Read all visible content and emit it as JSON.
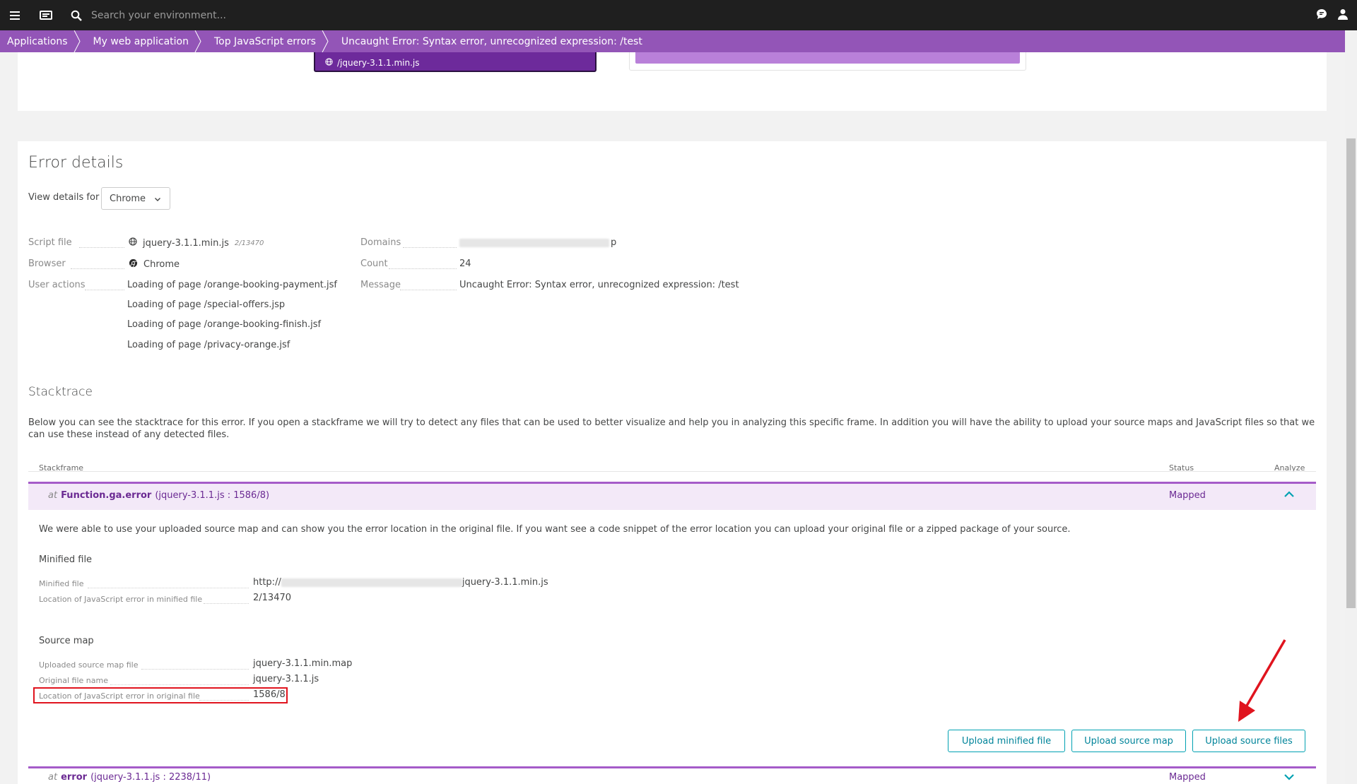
{
  "topbar": {
    "search_placeholder": "Search your environment...",
    "icons": [
      "menu-icon",
      "dashboard-icon",
      "search-icon",
      "chat-icon",
      "user-icon"
    ]
  },
  "breadcrumb": [
    "Applications",
    "My web application",
    "Top JavaScript errors",
    "Uncaught Error: Syntax error, unrecognized expression: /test"
  ],
  "top_card": {
    "tile_label": "/jquery-3.1.1.min.js"
  },
  "error_details": {
    "title": "Error details",
    "view_details_label": "View details for",
    "selected_browser": "Chrome",
    "left": [
      {
        "label": "Script file",
        "value": "jquery-3.1.1.min.js",
        "note": "2/13470",
        "icon": "globe-icon"
      },
      {
        "label": "Browser",
        "value": "Chrome",
        "icon": "chrome-icon"
      },
      {
        "label": "User actions",
        "values": [
          "Loading of page /orange-booking-payment.jsf",
          "Loading of page /special-offers.jsp",
          "Loading of page /orange-booking-finish.jsf",
          "Loading of page /privacy-orange.jsf"
        ]
      }
    ],
    "right": [
      {
        "label": "Domains",
        "value_suffix": "p"
      },
      {
        "label": "Count",
        "value": "24"
      },
      {
        "label": "Message",
        "value": "Uncaught Error: Syntax error, unrecognized expression: /test"
      }
    ]
  },
  "stacktrace": {
    "title": "Stacktrace",
    "description": "Below you can see the stacktrace for this error. If you open a stackframe we will try to detect any files that can be used to better visualize and help you in analyzing this specific frame. In addition you will have the ability to upload your source maps and JavaScript files so that we can use these instead of any detected files.",
    "columns": {
      "stackframe": "Stackframe",
      "status": "Status",
      "analyze": "Analyze"
    },
    "frames": [
      {
        "at": "at",
        "fn": "Function.ga.error",
        "loc": "(jquery-3.1.1.js : 1586/8)",
        "status": "Mapped"
      },
      {
        "at": "at",
        "fn": "error",
        "loc": "(jquery-3.1.1.js : 2238/11)",
        "status": "Mapped"
      }
    ],
    "open_frame": {
      "description": "We were able to use your uploaded source map and can show you the error location in the original file. If you want see a code snippet of the error location you can upload your original file or a zipped package of your source.",
      "minified_title": "Minified file",
      "minified_file_label": "Minified file",
      "minified_file_prefix": "http://",
      "minified_file_suffix": "jquery-3.1.1.min.js",
      "minified_location_label": "Location of JavaScript error in minified file",
      "minified_location": "2/13470",
      "sourcemap_title": "Source map",
      "sourcemap_file_label": "Uploaded source map file",
      "sourcemap_file": "jquery-3.1.1.min.map",
      "original_name_label": "Original file name",
      "original_name": "jquery-3.1.1.js",
      "original_location_label": "Location of JavaScript error in original file",
      "original_location": "1586/8"
    },
    "buttons": {
      "upload_minified": "Upload minified file",
      "upload_sourcemap": "Upload source map",
      "upload_source": "Upload source files"
    }
  },
  "colors": {
    "breadcrumb_bg": "#9355b7",
    "accent_purple": "#6b2a93",
    "button_teal": "#00a1b2",
    "highlight_red": "#e0141e"
  }
}
